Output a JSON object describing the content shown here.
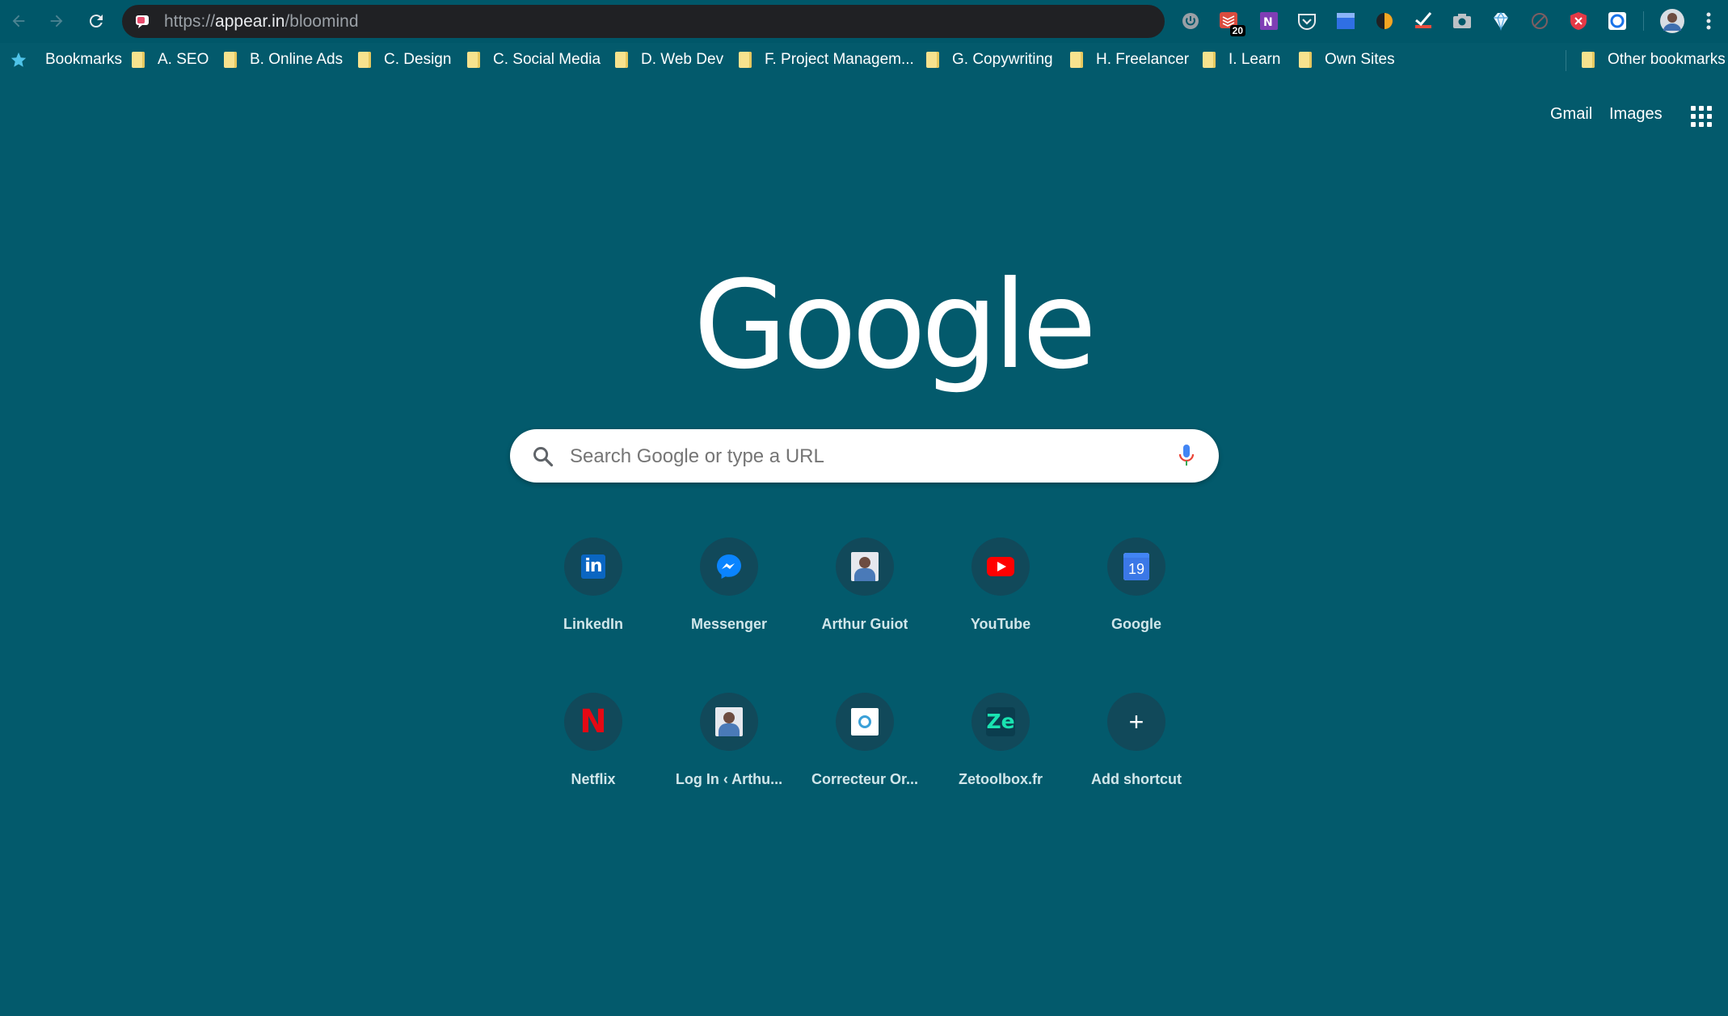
{
  "browser": {
    "url_scheme": "https://",
    "url_host": "appear.in",
    "url_path": "/bloomind",
    "extension_badge": "20"
  },
  "bookmarks": {
    "main_label": "Bookmarks",
    "folders": [
      "A. SEO",
      "B. Online Ads",
      "C. Design",
      "C. Social Media",
      "D. Web Dev",
      "F. Project Managem...",
      "G. Copywriting",
      "H. Freelancer",
      "I. Learn",
      "Own Sites"
    ],
    "other_label": "Other bookmarks"
  },
  "header": {
    "gmail": "Gmail",
    "images": "Images"
  },
  "logo": "Google",
  "search": {
    "placeholder": "Search Google or type a URL"
  },
  "shortcuts": [
    {
      "label": "LinkedIn",
      "icon": "linkedin-icon"
    },
    {
      "label": "Messenger",
      "icon": "messenger-icon"
    },
    {
      "label": "Arthur Guiot",
      "icon": "arthur-guiot-favicon"
    },
    {
      "label": "YouTube",
      "icon": "youtube-icon"
    },
    {
      "label": "Google",
      "icon": "google-calendar-icon",
      "text": "19"
    },
    {
      "label": "Netflix",
      "icon": "netflix-icon",
      "text": "N"
    },
    {
      "label": "Log In ‹ Arthu...",
      "icon": "login-arthur-favicon"
    },
    {
      "label": "Correcteur Or...",
      "icon": "correcteur-favicon"
    },
    {
      "label": "Zetoolbox.fr",
      "icon": "zetoolbox-icon",
      "text": "Ze"
    },
    {
      "label": "Add shortcut",
      "icon": "plus-icon",
      "text": "+"
    }
  ],
  "colors": {
    "background": "#035a6c",
    "tile_circle": "#11495a",
    "omnibox": "#202124"
  }
}
